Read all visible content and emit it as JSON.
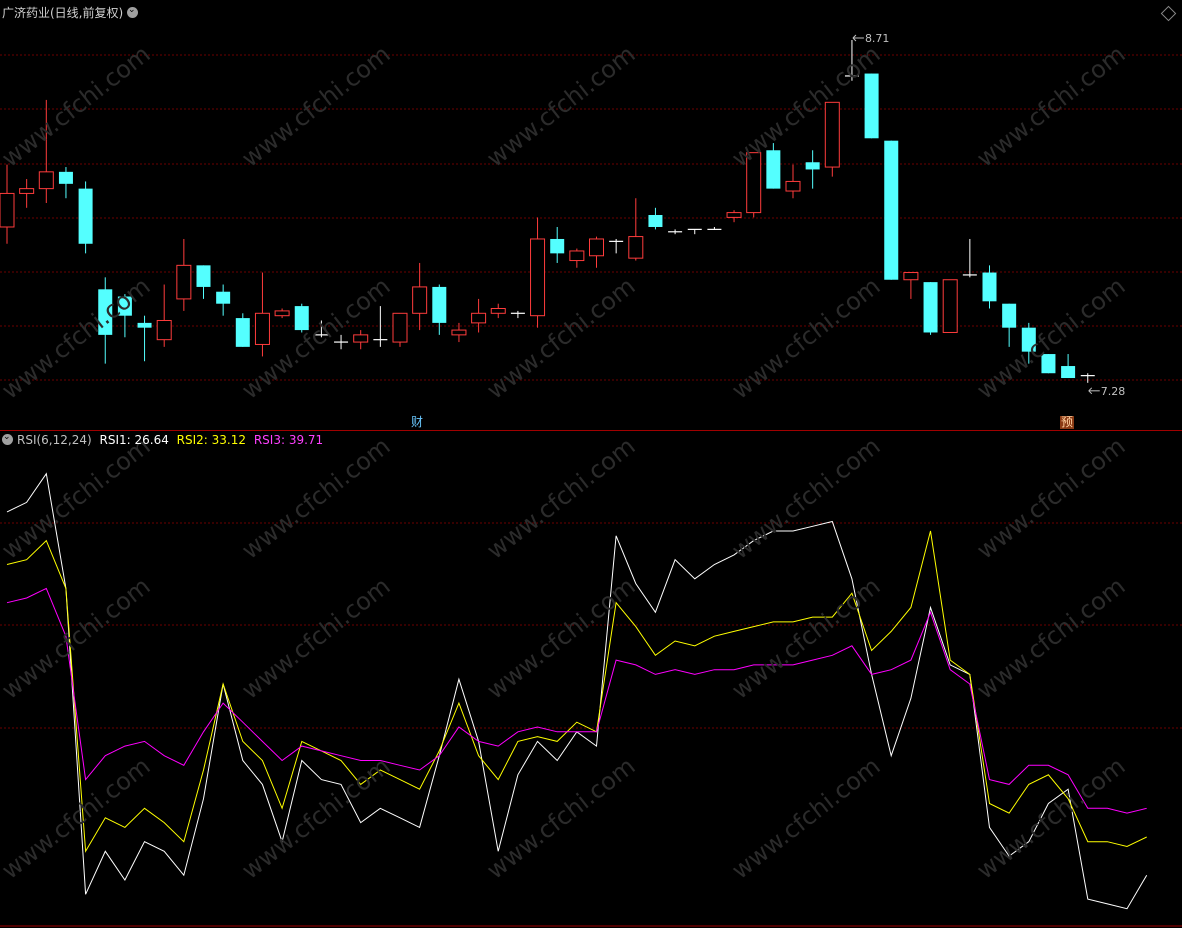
{
  "title": "广济药业(日线,前复权)",
  "rsi_header": {
    "name": "RSI(6,12,24)",
    "rsi1_label": "RSI1: 26.64",
    "rsi2_label": "RSI2: 33.12",
    "rsi3_label": "RSI3: 39.71"
  },
  "badges": {
    "cai": "财",
    "yu": "预"
  },
  "watermark": "www.cfchi.com",
  "colors": {
    "up": "#ff3c3c",
    "down": "#54ffff",
    "rsi1": "#ffffff",
    "rsi2": "#ffff00",
    "rsi3": "#ff00ff",
    "grid": "#6b0000",
    "border": "#a00000",
    "text": "#c0c0c0"
  },
  "chart_data": [
    {
      "type": "candlestick",
      "title": "广济药业(日线,前复权)",
      "annotations": [
        {
          "label": "8.71",
          "kind": "high",
          "index": 43
        },
        {
          "label": "7.28",
          "kind": "low",
          "index": 55
        }
      ],
      "ylim": [
        7.2,
        8.76
      ],
      "series": [
        {
          "name": "",
          "ohlc": [
            [
              7.93,
              8.19,
              7.86,
              8.07
            ],
            [
              8.07,
              8.13,
              8.01,
              8.09
            ],
            [
              8.09,
              8.46,
              8.03,
              8.16
            ],
            [
              8.16,
              8.18,
              8.05,
              8.11
            ],
            [
              8.09,
              8.12,
              7.82,
              7.86
            ],
            [
              7.67,
              7.72,
              7.36,
              7.48
            ],
            [
              7.64,
              7.65,
              7.47,
              7.56
            ],
            [
              7.53,
              7.56,
              7.37,
              7.51
            ],
            [
              7.46,
              7.69,
              7.43,
              7.54
            ],
            [
              7.63,
              7.88,
              7.58,
              7.77
            ],
            [
              7.77,
              7.72,
              7.63,
              7.68
            ],
            [
              7.66,
              7.69,
              7.56,
              7.61
            ],
            [
              7.55,
              7.57,
              7.43,
              7.43
            ],
            [
              7.44,
              7.74,
              7.39,
              7.57
            ],
            [
              7.56,
              7.59,
              7.55,
              7.58
            ],
            [
              7.6,
              7.61,
              7.49,
              7.5
            ],
            [
              7.49,
              7.54,
              7.47,
              7.48
            ],
            [
              7.46,
              7.48,
              7.42,
              7.45
            ],
            [
              7.45,
              7.5,
              7.42,
              7.48
            ],
            [
              7.46,
              7.6,
              7.43,
              7.46
            ],
            [
              7.45,
              7.56,
              7.43,
              7.57
            ],
            [
              7.57,
              7.78,
              7.5,
              7.68
            ],
            [
              7.68,
              7.69,
              7.48,
              7.53
            ],
            [
              7.48,
              7.53,
              7.45,
              7.5
            ],
            [
              7.53,
              7.63,
              7.49,
              7.57
            ],
            [
              7.57,
              7.61,
              7.55,
              7.59
            ],
            [
              7.57,
              7.58,
              7.55,
              7.57
            ],
            [
              7.56,
              7.97,
              7.51,
              7.88
            ],
            [
              7.88,
              7.93,
              7.78,
              7.82
            ],
            [
              7.79,
              7.84,
              7.76,
              7.83
            ],
            [
              7.81,
              7.89,
              7.76,
              7.88
            ],
            [
              7.88,
              7.88,
              7.82,
              7.87
            ],
            [
              7.8,
              8.05,
              7.79,
              7.89
            ],
            [
              7.98,
              8.01,
              7.92,
              7.93
            ],
            [
              7.91,
              7.92,
              7.9,
              7.91
            ],
            [
              7.92,
              7.91,
              7.9,
              7.92
            ],
            [
              7.93,
              7.91,
              7.92,
              7.92
            ],
            [
              7.97,
              8.0,
              7.95,
              7.99
            ],
            [
              7.99,
              8.23,
              7.97,
              8.24
            ],
            [
              8.25,
              8.28,
              8.09,
              8.09
            ],
            [
              8.08,
              8.19,
              8.05,
              8.12
            ],
            [
              8.2,
              8.25,
              8.09,
              8.17
            ],
            [
              8.18,
              8.45,
              8.14,
              8.45
            ],
            [
              8.56,
              8.71,
              8.54,
              8.56
            ],
            [
              8.57,
              8.54,
              8.3,
              8.3
            ],
            [
              8.29,
              8.28,
              7.71,
              7.71
            ],
            [
              7.71,
              7.74,
              7.63,
              7.74
            ],
            [
              7.7,
              7.7,
              7.48,
              7.49
            ],
            [
              7.49,
              7.49,
              7.49,
              7.71
            ],
            [
              7.72,
              7.88,
              7.72,
              7.73
            ],
            [
              7.74,
              7.77,
              7.59,
              7.62
            ],
            [
              7.61,
              7.6,
              7.43,
              7.51
            ],
            [
              7.51,
              7.53,
              7.36,
              7.41
            ],
            [
              7.4,
              7.38,
              7.38,
              7.32
            ],
            [
              7.35,
              7.4,
              7.32,
              7.3
            ],
            [
              7.3,
              7.32,
              7.28,
              7.31
            ]
          ]
        }
      ]
    },
    {
      "type": "line",
      "title": "RSI(6,12,24)",
      "ylim": [
        0,
        100
      ],
      "series": [
        {
          "name": "RSI1",
          "values": [
            86,
            88,
            94,
            70,
            6,
            15,
            9,
            17,
            15,
            10,
            26,
            50,
            34,
            29,
            17,
            34,
            30,
            29,
            21,
            24,
            22,
            20,
            35,
            51,
            38,
            15,
            31,
            38,
            34,
            40,
            37,
            81,
            71,
            65,
            76,
            72,
            75,
            77,
            80,
            82,
            82,
            83,
            84,
            72,
            52,
            35,
            47,
            66,
            54,
            52,
            20,
            14,
            17,
            25,
            28,
            5,
            4,
            3,
            10
          ]
        },
        {
          "name": "RSI2",
          "values": [
            75,
            76,
            80,
            70,
            15,
            22,
            20,
            24,
            21,
            17,
            32,
            50,
            38,
            34,
            24,
            38,
            36,
            34,
            29,
            32,
            30,
            28,
            36,
            46,
            35,
            30,
            38,
            39,
            38,
            42,
            40,
            67,
            62,
            56,
            59,
            58,
            60,
            61,
            62,
            63,
            63,
            64,
            64,
            69,
            57,
            61,
            66,
            82,
            55,
            52,
            25,
            23,
            29,
            31,
            26,
            17,
            17,
            16,
            18
          ]
        },
        {
          "name": "RSI3",
          "values": [
            67,
            68,
            70,
            60,
            30,
            35,
            37,
            38,
            35,
            33,
            40,
            46,
            42,
            38,
            34,
            37,
            36,
            35,
            34,
            34,
            33,
            32,
            35,
            41,
            38,
            37,
            40,
            41,
            40,
            40,
            40,
            55,
            54,
            52,
            53,
            52,
            53,
            53,
            54,
            54,
            54,
            55,
            56,
            58,
            52,
            53,
            55,
            65,
            53,
            50,
            30,
            29,
            33,
            33,
            31,
            24,
            24,
            23,
            24
          ]
        }
      ]
    }
  ]
}
